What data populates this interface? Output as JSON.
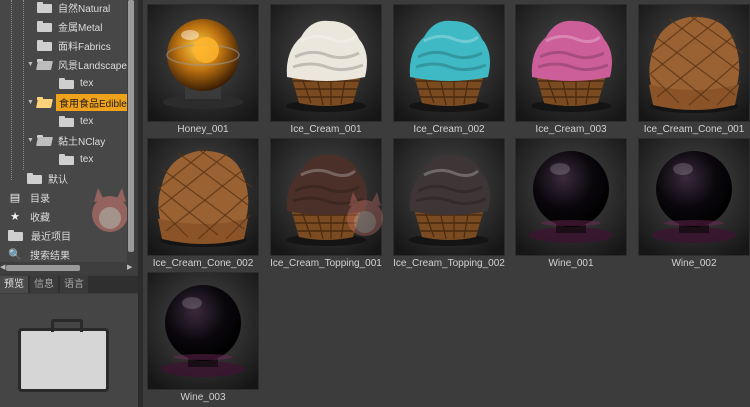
{
  "tree": {
    "items": [
      {
        "label": "自然Natural",
        "level": 2,
        "icon": "folder-icon",
        "expander": ""
      },
      {
        "label": "金属Metal",
        "level": 2,
        "icon": "folder-icon",
        "expander": ""
      },
      {
        "label": "面料Fabrics",
        "level": 2,
        "icon": "folder-icon",
        "expander": ""
      },
      {
        "label": "风景Landscape",
        "level": 2,
        "icon": "folder-open-icon",
        "expander": "▼"
      },
      {
        "label": "tex",
        "level": 3,
        "icon": "folder-icon",
        "expander": ""
      },
      {
        "label": "食用食品Edibles",
        "level": 2,
        "icon": "folder-open-icon",
        "expander": "▼",
        "selected": true
      },
      {
        "label": "tex",
        "level": 3,
        "icon": "folder-icon",
        "expander": ""
      },
      {
        "label": "黏土NClay",
        "level": 2,
        "icon": "folder-open-icon",
        "expander": "▼"
      },
      {
        "label": "tex",
        "level": 3,
        "icon": "folder-icon",
        "expander": ""
      },
      {
        "label": "默认",
        "level": 1,
        "icon": "folder-icon",
        "expander": ""
      }
    ],
    "special": [
      {
        "label": "目录",
        "icon": "catalog-icon",
        "glyph": "▤"
      },
      {
        "label": "收藏",
        "icon": "star-icon",
        "glyph": "★"
      },
      {
        "label": "最近项目",
        "icon": "recent-folder-icon",
        "glyph": ""
      },
      {
        "label": "搜索结果",
        "icon": "search-icon",
        "glyph": "🔍"
      }
    ]
  },
  "tabs": [
    "预览",
    "信息",
    "语言"
  ],
  "grid": {
    "items": [
      {
        "name": "Honey_001",
        "kind": "honey"
      },
      {
        "name": "Ice_Cream_001",
        "kind": "icecream",
        "color": "#ece7dc"
      },
      {
        "name": "Ice_Cream_002",
        "kind": "icecream",
        "color": "#3fb9c4"
      },
      {
        "name": "Ice_Cream_003",
        "kind": "icecream",
        "color": "#cc5e9a"
      },
      {
        "name": "Ice_Cream_Cone_001",
        "kind": "cone"
      },
      {
        "name": "Ice_Cream_Cone_002",
        "kind": "cone"
      },
      {
        "name": "Ice_Cream_Topping_001",
        "kind": "icecream",
        "color": "#4a3029"
      },
      {
        "name": "Ice_Cream_Topping_002",
        "kind": "icecream",
        "color": "#3d3536"
      },
      {
        "name": "Wine_001",
        "kind": "wine"
      },
      {
        "name": "Wine_002",
        "kind": "wine"
      },
      {
        "name": "Wine_003",
        "kind": "wine"
      }
    ]
  },
  "colors": {
    "selection": "#f0a21a",
    "panel": "#474747",
    "background": "#3c3c3c"
  }
}
